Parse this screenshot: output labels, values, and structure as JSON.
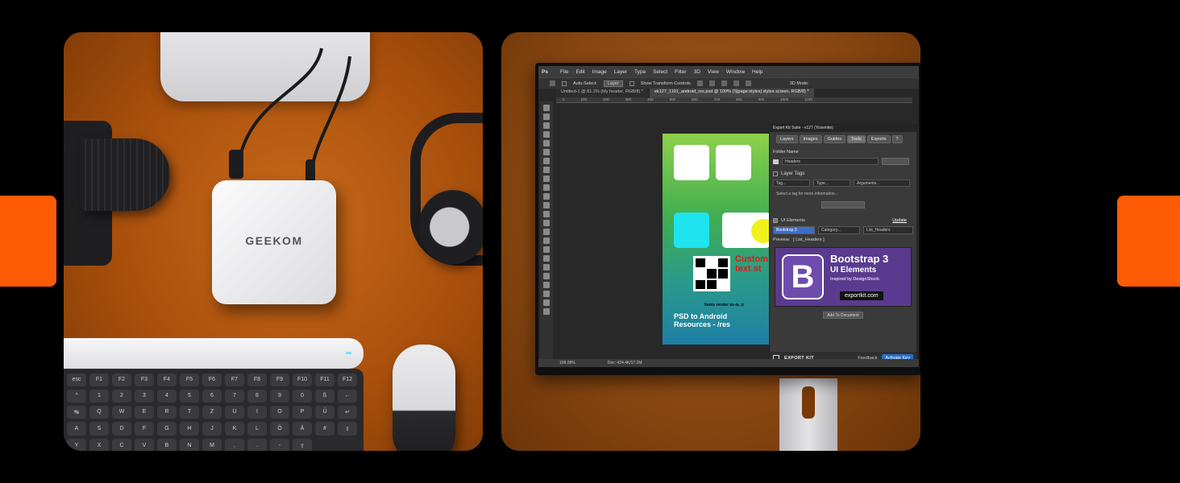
{
  "page": {
    "accent": "#fe5b04",
    "background": "#000000",
    "desk_color": "#a84f0c"
  },
  "desk": {
    "minipc_brand": "GEEKOM",
    "keyboard_keys": [
      "esc",
      "F1",
      "F2",
      "F3",
      "F4",
      "F5",
      "F6",
      "F7",
      "F8",
      "F9",
      "F10",
      "F11",
      "F12",
      "^",
      "1",
      "2",
      "3",
      "4",
      "5",
      "6",
      "7",
      "8",
      "9",
      "0",
      "ß",
      "←",
      "↹",
      "Q",
      "W",
      "E",
      "R",
      "T",
      "Z",
      "U",
      "I",
      "O",
      "P",
      "Ü",
      "↵",
      "A",
      "S",
      "D",
      "F",
      "G",
      "H",
      "J",
      "K",
      "L",
      "Ö",
      "Ä",
      "#",
      "⇧",
      "Y",
      "X",
      "C",
      "V",
      "B",
      "N",
      "M",
      ",",
      ".",
      "-",
      "⇧"
    ],
    "icons": [
      "laptop",
      "mini-pc",
      "camera",
      "headphones",
      "keyboard",
      "mouse"
    ]
  },
  "photoshop": {
    "app_icon": "Ps",
    "menu": [
      "File",
      "Edit",
      "Image",
      "Layer",
      "Type",
      "Select",
      "Filter",
      "3D",
      "View",
      "Window",
      "Help"
    ],
    "options": {
      "auto_select_label": "Auto-Select:",
      "auto_select_value": "Layer",
      "transform_label": "Show Transform Controls",
      "mode_label": "3D Mode:"
    },
    "doc_tabs": [
      {
        "label": "Untitled-1 @ 81.2% (My header, RGB/8) *",
        "active": false
      },
      {
        "label": "ek127_1101_android_res.psd @ 109% (S[page:styles] styles screen, RGB/8) *",
        "active": true
      }
    ],
    "ruler_ticks": [
      "0",
      "100",
      "200",
      "300",
      "400",
      "500",
      "600",
      "700",
      "800",
      "900",
      "1000",
      "1100"
    ],
    "status": {
      "zoom": "109.09%",
      "doc": "Doc: 424.4K/17.2M"
    },
    "artboard": {
      "red_text_1": "Custom",
      "red_text_2": "text st",
      "footer_1": "PSD to Android",
      "footer_2": "Resources - /res",
      "small_text": "Items render as-is, p"
    }
  },
  "export_kit": {
    "title": "Export Kit Suite - v127 (Yosemite)",
    "tabs": [
      {
        "label": "Layers",
        "active": false
      },
      {
        "label": "Images",
        "active": false
      },
      {
        "label": "Guides",
        "active": false
      },
      {
        "label": "Tools",
        "active": true
      },
      {
        "label": "Exports",
        "active": false
      },
      {
        "label": "?",
        "active": false
      }
    ],
    "folder_name_label": "Folder Name",
    "folder_name_value": "Headers",
    "layer_tags_label": "Layer Tags",
    "tag_placeholder": "Tag...",
    "type_placeholder": "Type...",
    "arguments_placeholder": "Arguments...",
    "tag_hint": "Select a tag for more information...",
    "ui_elements_label": "UI Elements",
    "update_link": "Update",
    "framework_value": "Bootstrap 3",
    "category_value": "Category...",
    "list_value": "List_Headers",
    "preview_label": "Preview:",
    "preview_value": "[ List_Headers ]",
    "preview_card": {
      "logo_letter": "B",
      "title": "Bootstrap 3",
      "subtitle": "UI Elements",
      "credit": "Inspired by DesignShock",
      "site": "exportkit.com",
      "color": "#5a3a8e"
    },
    "add_button": "Add To Document",
    "brand": "EXPORT KIT",
    "feedback": "Feedback",
    "activate": "Activate Key"
  }
}
